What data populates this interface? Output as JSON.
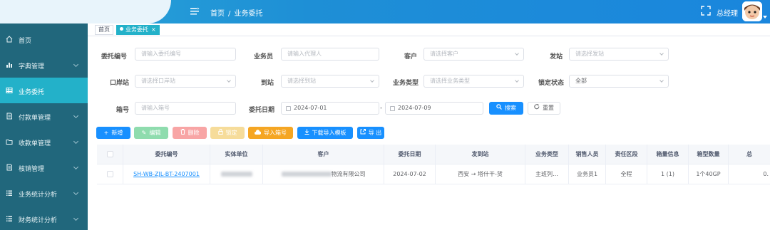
{
  "header": {
    "breadcrumb_home": "首页",
    "breadcrumb_sep": "/",
    "breadcrumb_current": "业务委托",
    "username": "总经理"
  },
  "sidebar": {
    "items": [
      {
        "label": "首页",
        "icon": "home-icon",
        "active": false,
        "has_children": false
      },
      {
        "label": "字典管理",
        "icon": "bar-chart-icon",
        "active": false,
        "has_children": true
      },
      {
        "label": "业务委托",
        "icon": "grid-icon",
        "active": true,
        "has_children": false
      },
      {
        "label": "付款单管理",
        "icon": "document-icon",
        "active": false,
        "has_children": true
      },
      {
        "label": "收款单管理",
        "icon": "folder-icon",
        "active": false,
        "has_children": true
      },
      {
        "label": "核销管理",
        "icon": "document-icon",
        "active": false,
        "has_children": true
      },
      {
        "label": "业务统计分析",
        "icon": "list-icon",
        "active": false,
        "has_children": true
      },
      {
        "label": "财务统计分析",
        "icon": "list-icon",
        "active": false,
        "has_children": true
      }
    ]
  },
  "tabs": [
    {
      "label": "首页",
      "active": false
    },
    {
      "label": "业务委托",
      "active": true,
      "close": "×"
    }
  ],
  "filters": {
    "entrust_no": {
      "label": "委托编号",
      "placeholder": "请输入委托编号"
    },
    "salesman": {
      "label": "业务员",
      "placeholder": "请输入代理人"
    },
    "customer": {
      "label": "客户",
      "placeholder": "请选择客户"
    },
    "departure": {
      "label": "发站",
      "placeholder": "请选择发站"
    },
    "port": {
      "label": "口岸站",
      "placeholder": "请选择口岸站"
    },
    "arrival": {
      "label": "到站",
      "placeholder": "请选择到站"
    },
    "biz_type": {
      "label": "业务类型",
      "placeholder": "请选择业务类型"
    },
    "lock_status": {
      "label": "锁定状态",
      "value": "全部"
    },
    "box_no": {
      "label": "箱号",
      "placeholder": "请输入箱号"
    },
    "entrust_date": {
      "label": "委托日期",
      "start": "2024-07-01",
      "end": "2024-07-09",
      "sep": "-"
    },
    "search_label": "搜索",
    "reset_label": "重置"
  },
  "toolbar": {
    "add": "新增",
    "edit": "编辑",
    "delete": "删除",
    "lock": "锁定",
    "import_box": "导入箱号",
    "download_template": "下载导入模板",
    "export": "导 出"
  },
  "table": {
    "columns": [
      "委托编号",
      "实体单位",
      "客户",
      "委托日期",
      "发到站",
      "业务类型",
      "销售人员",
      "责任区段",
      "箱量信息",
      "箱型数量",
      "总"
    ],
    "rows": [
      {
        "entrust_no": "SH-WB-ZJL-BT-2407001",
        "customer_suffix": "物流有限公司",
        "date": "2024-07-02",
        "route": "西安 → 塔什干-货",
        "biz_type": "主班列…",
        "sales": "业务员1",
        "section": "全程",
        "box_info": "1 (1)",
        "box_type_qty": "1个40GP",
        "total": "0."
      }
    ]
  },
  "colors": {
    "sidebar_bg": "#21677c",
    "sidebar_active": "#23b1c9",
    "header_bg": "#1e8fd6",
    "primary": "#1890ff"
  }
}
